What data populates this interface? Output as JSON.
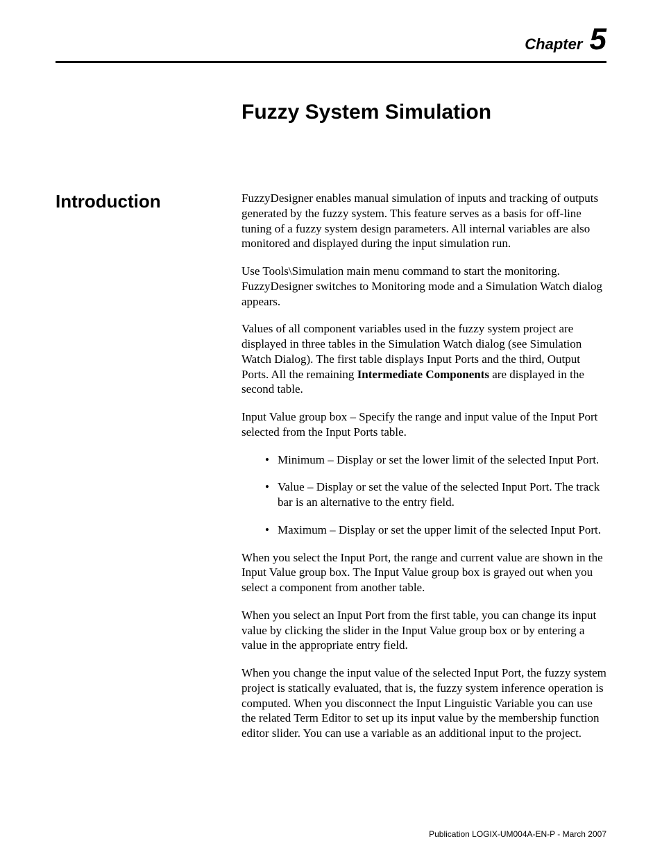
{
  "header": {
    "chapter_word": "Chapter",
    "chapter_number": "5"
  },
  "title": "Fuzzy System Simulation",
  "section_heading": "Introduction",
  "paragraphs": {
    "p1": "FuzzyDesigner enables manual simulation of inputs and tracking of outputs generated by the fuzzy system. This feature serves as a basis for off-line tuning of a fuzzy system design parameters. All internal variables are also monitored and displayed during the input simulation run.",
    "p2": "Use Tools\\Simulation main menu command to start the monitoring. FuzzyDesigner switches to Monitoring mode and a Simulation Watch dialog appears.",
    "p3_pre": "Values of all component variables used in the fuzzy system project are displayed in three tables in the Simulation Watch dialog (see Simulation Watch Dialog). The first table displays Input Ports and the third, Output Ports. All the remaining ",
    "p3_bold": "Intermediate Components",
    "p3_post": " are displayed in the second table.",
    "p4": "Input Value group box – Specify the range and input value of the Input Port selected from the Input Ports table.",
    "p5": "When you select the Input Port, the range and current value are shown in the Input Value group box. The Input Value group box is grayed out when you select a component from another table.",
    "p6": "When you select an Input Port from the first table, you can change its input value by clicking the slider in the Input Value group box or by entering a value in the appropriate entry field.",
    "p7": "When you change the input value of the selected Input Port, the fuzzy system project is statically evaluated, that is, the fuzzy system inference operation is computed. When you disconnect the Input Linguistic Variable you can use the related Term Editor to set up its input value by the membership function editor slider. You can use a variable as an additional input to the project."
  },
  "bullets": {
    "b1": "Minimum – Display or set the lower limit of the selected Input Port.",
    "b2": "Value – Display or set the value of the selected Input Port. The track bar is an alternative to the entry field.",
    "b3": "Maximum – Display or set the upper limit of the selected Input Port."
  },
  "footer": "Publication LOGIX-UM004A-EN-P - March 2007"
}
